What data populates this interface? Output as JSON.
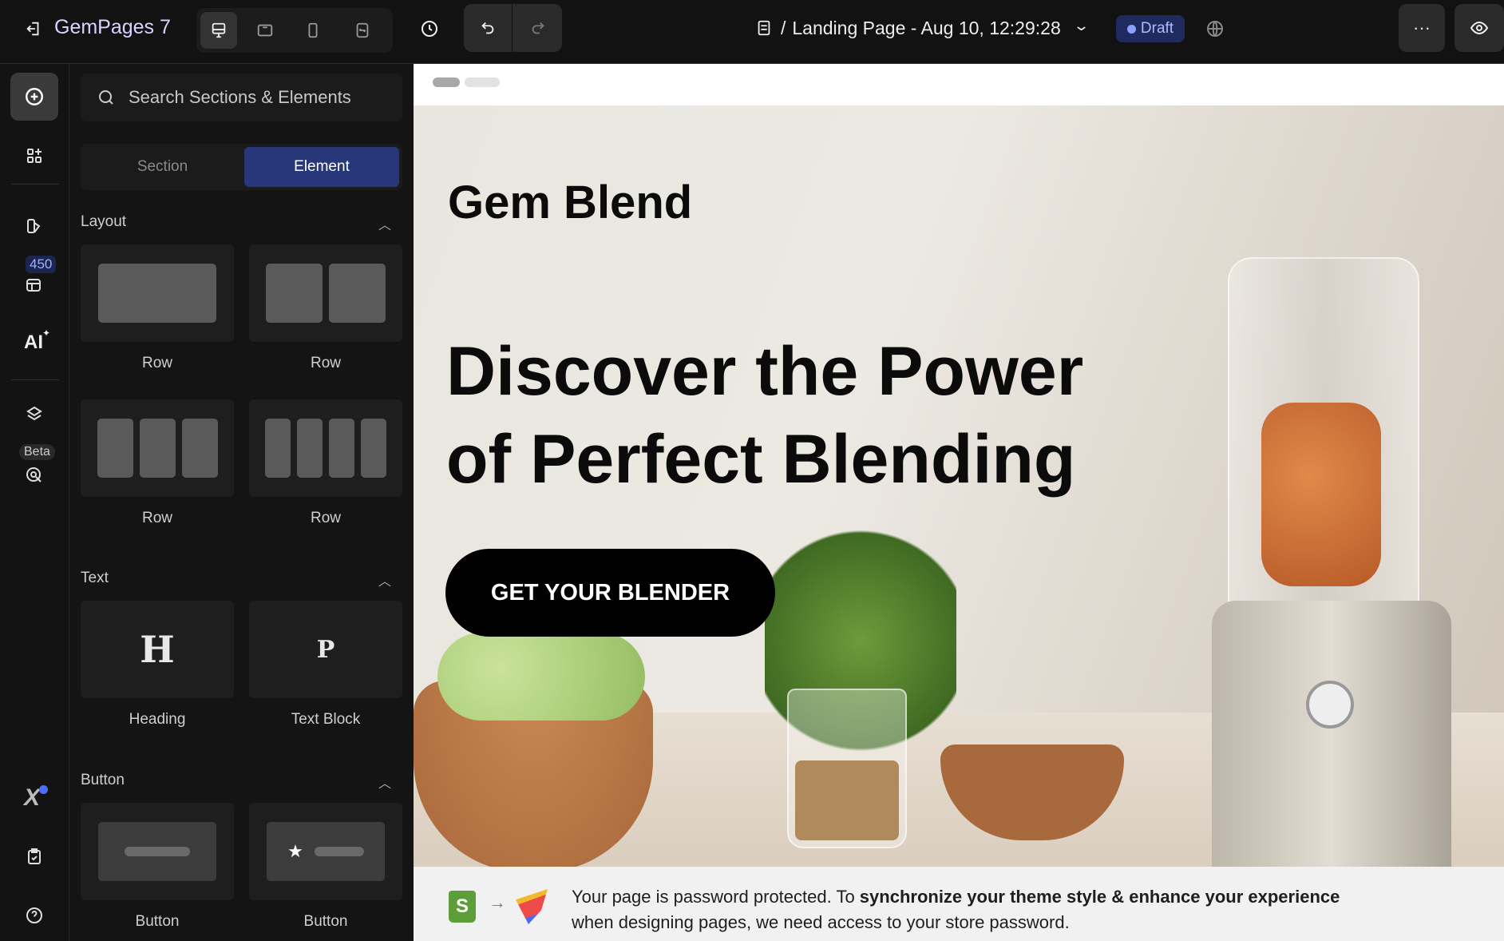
{
  "topbar": {
    "logo": "GemPages 7",
    "page_prefix": "/",
    "page_title": "Landing Page - Aug 10, 12:29:28",
    "status": "Draft",
    "more": "···"
  },
  "sidebar_rail": {
    "credits_badge": "450",
    "beta_badge": "Beta",
    "ai_label": "AI"
  },
  "panel": {
    "search_placeholder": "Search Sections & Elements",
    "tabs": [
      {
        "label": "Section"
      },
      {
        "label": "Element"
      }
    ],
    "groups": [
      {
        "title": "Layout",
        "items": [
          "Row",
          "Row",
          "Row",
          "Row"
        ]
      },
      {
        "title": "Text",
        "items": [
          "Heading",
          "Text Block"
        ]
      },
      {
        "title": "Button",
        "items": [
          "Button",
          "Button"
        ]
      }
    ],
    "heading_glyph": "H",
    "paragraph_glyph": "P"
  },
  "hero": {
    "brand": "Gem Blend",
    "headline_1": "Discover the Power",
    "headline_2": "of Perfect Blending",
    "cta": "GET YOUR BLENDER"
  },
  "banner": {
    "text_plain": "Your page is password protected. To ",
    "text_bold": "synchronize your theme style & enhance your experience",
    "text_line2": "when designing pages, we need access to your store password.",
    "arrow": "→"
  },
  "colors": {
    "accent": "#2b3a7a",
    "draft_bg": "#1f2b5e",
    "draft_dot": "#8aa2ff"
  }
}
